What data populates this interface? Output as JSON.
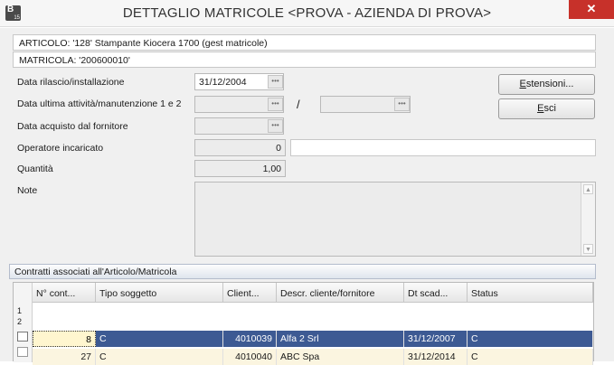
{
  "window": {
    "title": "DETTAGLIO MATRICOLE <PROVA - AZIENDA DI PROVA>",
    "icon_letter": "B",
    "icon_number": "15",
    "close_glyph": "✕"
  },
  "header": {
    "articolo": "ARTICOLO: '128' Stampante Kiocera 1700  (gest matricole)",
    "matricola": "MATRICOLA: '200600010'"
  },
  "form": {
    "data_rilascio": {
      "label": "Data rilascio/installazione",
      "value": "31/12/2004"
    },
    "data_ultima": {
      "label": "Data ultima attività/manutenzione 1 e 2",
      "value1": "",
      "value2": "",
      "separator": "/"
    },
    "data_acquisto": {
      "label": "Data acquisto dal fornitore",
      "value": ""
    },
    "operatore": {
      "label": "Operatore incaricato",
      "value": "0",
      "description": ""
    },
    "quantita": {
      "label": "Quantità",
      "value": "1,00"
    },
    "note": {
      "label": "Note",
      "value": ""
    }
  },
  "buttons": {
    "estensioni": {
      "mnemonic": "E",
      "rest": "stensioni..."
    },
    "esci": {
      "mnemonic": "E",
      "rest": "sci"
    }
  },
  "contracts": {
    "section_title": "Contratti associati all'Articolo/Matricola",
    "columns": [
      "N° cont...",
      "Tipo soggetto",
      "Client...",
      "Descr. cliente/fornitore",
      "Dt scad...",
      "Status"
    ],
    "rows": [
      {
        "index": "1",
        "numero": "8",
        "tipo": "C",
        "cliente": "4010039",
        "descr": "Alfa 2 Srl",
        "scadenza": "31/12/2007",
        "status": "C"
      },
      {
        "index": "2",
        "numero": "27",
        "tipo": "C",
        "cliente": "4010040",
        "descr": "ABC Spa",
        "scadenza": "31/12/2014",
        "status": "C"
      }
    ],
    "selected_row": 1
  },
  "icons": {
    "dropdown": "ellipsis-icon",
    "grid_tools": [
      "grid-settings-icon",
      "grid-list-icon"
    ]
  },
  "colors": {
    "selected_row": "#3d5a93",
    "alt_row": "#fbf5e0",
    "close_button": "#c7312a"
  }
}
